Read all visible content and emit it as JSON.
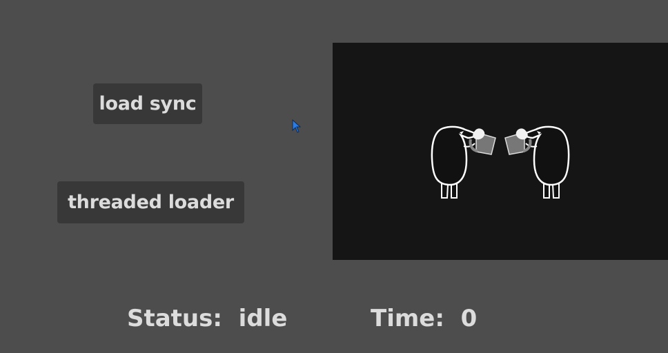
{
  "buttons": {
    "load_sync_label": "load sync",
    "threaded_loader_label": "threaded loader"
  },
  "status": {
    "label": "Status:",
    "value": "idle"
  },
  "time": {
    "label": "Time:",
    "value": "0"
  },
  "viewport": {
    "image": "penguins-toasting-mugs"
  },
  "colors": {
    "background": "#4d4d4d",
    "button": "#383838",
    "viewport": "#151515",
    "text": "#dcdcdc",
    "cursor": "#2a7be4"
  },
  "icons": {
    "cursor": "mouse-pointer-icon"
  }
}
